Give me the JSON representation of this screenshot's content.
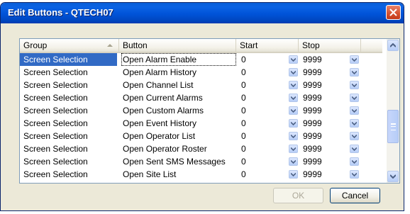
{
  "window": {
    "title": "Edit Buttons - QTECH07"
  },
  "grid": {
    "columns": [
      "Group",
      "Button",
      "Start",
      "Stop"
    ],
    "sorted_column": "Group",
    "rows": [
      {
        "group": "Screen Selection",
        "button": "Open Alarm Enable",
        "start": "0",
        "stop": "9999"
      },
      {
        "group": "Screen Selection",
        "button": "Open Alarm History",
        "start": "0",
        "stop": "9999"
      },
      {
        "group": "Screen Selection",
        "button": "Open Channel List",
        "start": "0",
        "stop": "9999"
      },
      {
        "group": "Screen Selection",
        "button": "Open Current Alarms",
        "start": "0",
        "stop": "9999"
      },
      {
        "group": "Screen Selection",
        "button": "Open Custom Alarms",
        "start": "0",
        "stop": "9999"
      },
      {
        "group": "Screen Selection",
        "button": "Open Event History",
        "start": "0",
        "stop": "9999"
      },
      {
        "group": "Screen Selection",
        "button": "Open Operator List",
        "start": "0",
        "stop": "9999"
      },
      {
        "group": "Screen Selection",
        "button": "Open Operator Roster",
        "start": "0",
        "stop": "9999"
      },
      {
        "group": "Screen Selection",
        "button": "Open Sent SMS Messages",
        "start": "0",
        "stop": "9999"
      },
      {
        "group": "Screen Selection",
        "button": "Open Site List",
        "start": "0",
        "stop": "9999"
      }
    ],
    "selected_row": 0
  },
  "buttons": {
    "ok_label": "OK",
    "cancel_label": "Cancel"
  },
  "colors": {
    "title_bar": "#0053d8",
    "selection": "#316ac5",
    "dialog_bg": "#ece9d8",
    "close_button": "#d4502e"
  },
  "icons": [
    "close-icon",
    "sort-ascending-icon",
    "dropdown-arrow-icon",
    "scroll-up-icon",
    "scroll-down-icon"
  ]
}
